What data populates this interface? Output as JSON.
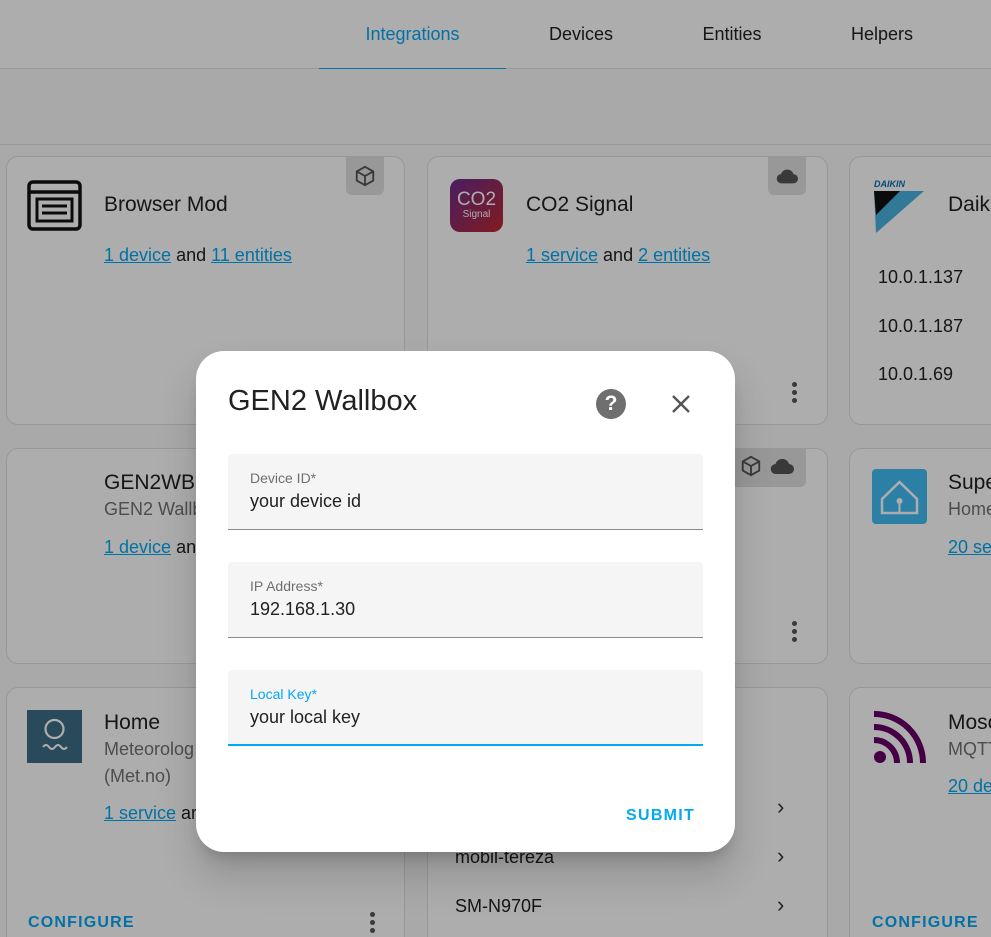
{
  "tabs": [
    {
      "label": "Integrations",
      "active": true
    },
    {
      "label": "Devices"
    },
    {
      "label": "Entities"
    },
    {
      "label": "Helpers"
    }
  ],
  "cards": {
    "browser_mod": {
      "title": "Browser Mod",
      "link1": "1 device",
      "and": "and",
      "link2": "11 entities"
    },
    "co2": {
      "title": "CO2 Signal",
      "link1": "1 service",
      "and": "and",
      "link2": "2 entities",
      "logo_main": "CO2",
      "logo_sub": "Signal"
    },
    "daikin": {
      "title": "Daiki",
      "logo": "DAIKIN",
      "ips": [
        "10.0.1.137",
        "10.0.1.187",
        "10.0.1.69"
      ]
    },
    "gen2wb": {
      "title": "GEN2WB-",
      "subtitle": "GEN2 Wallb",
      "link1": "1 device",
      "and": "an"
    },
    "supervisor": {
      "title": "Supe",
      "subtitle": "Home",
      "link1": "20 se"
    },
    "home": {
      "title": "Home",
      "subtitle1": "Meteorolog",
      "subtitle2": "(Met.no)",
      "link1": "1 service",
      "and": "ar",
      "configure": "CONFIGURE"
    },
    "devices_list": {
      "rows": [
        "mobil-tereza",
        "SM-N970F"
      ]
    },
    "mosquitto": {
      "title": "Mosc",
      "subtitle": "MQTT",
      "link1": "20 de",
      "configure": "CONFIGURE"
    }
  },
  "dialog": {
    "title": "GEN2 Wallbox",
    "fields": [
      {
        "label": "Device ID*",
        "value": "your device id"
      },
      {
        "label": "IP Address*",
        "value": "192.168.1.30"
      },
      {
        "label": "Local Key*",
        "value": "your local key"
      }
    ],
    "submit": "SUBMIT"
  },
  "colors": {
    "accent": "#03a9f4",
    "scrim": "rgba(0,0,0,0.32)"
  }
}
